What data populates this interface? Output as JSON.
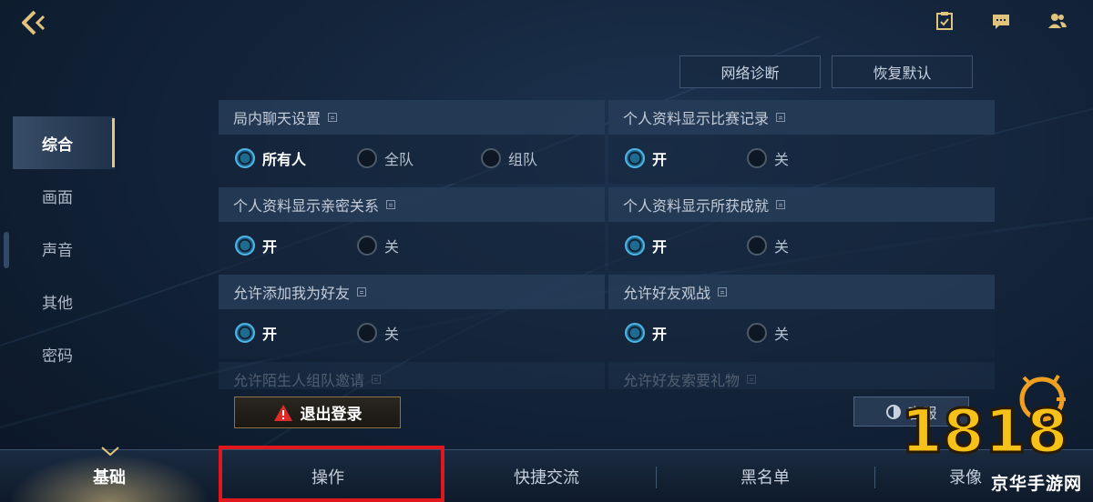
{
  "top_bar": {
    "buttons": {
      "network": "网络诊断",
      "reset": "恢复默认"
    }
  },
  "left_nav": [
    {
      "label": "综合",
      "active": true
    },
    {
      "label": "画面",
      "active": false
    },
    {
      "label": "声音",
      "active": false
    },
    {
      "label": "其他",
      "active": false
    },
    {
      "label": "密码",
      "active": false
    }
  ],
  "settings": {
    "chat": {
      "title": "局内聊天设置",
      "options": [
        "所有人",
        "全队",
        "组队"
      ],
      "selected": 0
    },
    "show_record": {
      "title": "个人资料显示比赛记录",
      "options": [
        "开",
        "关"
      ],
      "selected": 0
    },
    "show_intimacy": {
      "title": "个人资料显示亲密关系",
      "options": [
        "开",
        "关"
      ],
      "selected": 0
    },
    "show_achievements": {
      "title": "个人资料显示所获成就",
      "options": [
        "开",
        "关"
      ],
      "selected": 0
    },
    "allow_friend_add": {
      "title": "允许添加我为好友",
      "options": [
        "开",
        "关"
      ],
      "selected": 0
    },
    "allow_spectate": {
      "title": "允许好友观战",
      "options": [
        "开",
        "关"
      ],
      "selected": 0
    },
    "allow_stranger_invite": {
      "title": "允许陌生人组队邀请"
    },
    "allow_gift_request": {
      "title": "允许好友索要礼物"
    }
  },
  "actions": {
    "logout": "退出登录",
    "customer_service": "客服"
  },
  "tabbar": [
    {
      "label": "基础",
      "active": true
    },
    {
      "label": "操作",
      "active": false
    },
    {
      "label": "快捷交流",
      "active": false
    },
    {
      "label": "黑名单",
      "active": false
    },
    {
      "label": "录像",
      "active": false
    }
  ],
  "watermark": {
    "logo_text": "18183",
    "site": "京华手游网"
  },
  "colors": {
    "accent_gold": "#e6c77c",
    "radio_on": "#4fb5e6",
    "highlight": "#e0181e"
  }
}
